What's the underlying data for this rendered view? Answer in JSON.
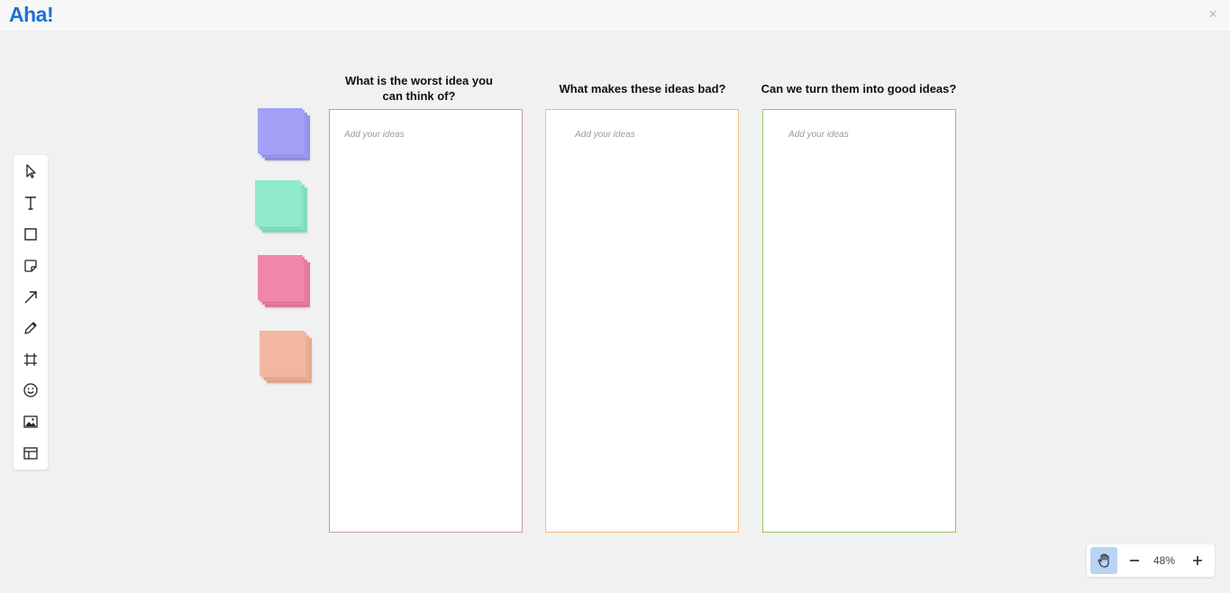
{
  "app": {
    "logo": "Aha!",
    "close_glyph": "×"
  },
  "toolbar": {
    "tools": [
      {
        "name": "select-tool",
        "icon": "cursor-arrow-icon"
      },
      {
        "name": "text-tool",
        "icon": "text-t-icon"
      },
      {
        "name": "shape-tool",
        "icon": "square-icon"
      },
      {
        "name": "sticky-note-tool",
        "icon": "sticky-note-icon"
      },
      {
        "name": "arrow-tool",
        "icon": "arrow-diagonal-icon"
      },
      {
        "name": "pen-tool",
        "icon": "pencil-icon"
      },
      {
        "name": "frame-tool",
        "icon": "frame-icon"
      },
      {
        "name": "emoji-tool",
        "icon": "smiley-icon"
      },
      {
        "name": "image-tool",
        "icon": "image-icon"
      },
      {
        "name": "template-tool",
        "icon": "layout-icon"
      }
    ]
  },
  "sticky_stacks": [
    {
      "name": "purple-sticky-stack",
      "color": "#a09cf7"
    },
    {
      "name": "green-sticky-stack",
      "color": "#8ce9c9"
    },
    {
      "name": "pink-sticky-stack",
      "color": "#ef82a8"
    },
    {
      "name": "peach-sticky-stack",
      "color": "#f2b49d"
    }
  ],
  "columns": [
    {
      "title": "What is the worst idea you can think of?",
      "placeholder": "Add your ideas",
      "border_color": "#c99aaa"
    },
    {
      "title": "What makes these ideas bad?",
      "placeholder": "Add your ideas",
      "border_color": "#f4be7a"
    },
    {
      "title": "Can we turn them into good ideas?",
      "placeholder": "Add your ideas",
      "border_color": "#97c56a"
    }
  ],
  "zoom": {
    "level": "48%",
    "minus": "−",
    "plus": "+"
  }
}
